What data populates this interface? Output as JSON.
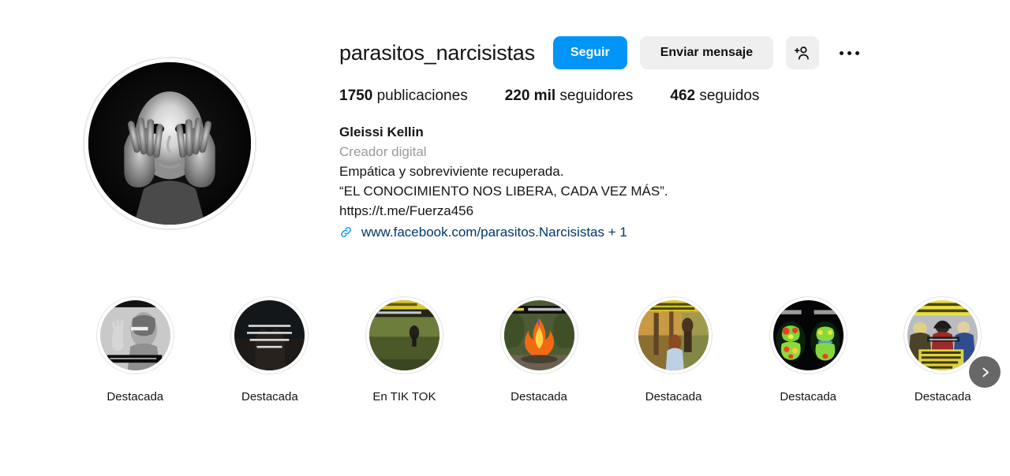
{
  "profile": {
    "username": "parasitos_narcisistas",
    "avatar_alt": "mask-face-held-by-hands-grayscale",
    "follow_label": "Seguir",
    "message_label": "Enviar mensaje",
    "add_person_icon": "add-person-icon",
    "more_options_icon": "ellipsis-icon",
    "stats": {
      "posts_value": "1750",
      "posts_label": "publicaciones",
      "followers_value": "220 mil",
      "followers_label": "seguidores",
      "following_value": "462",
      "following_label": "seguidos"
    },
    "bio": {
      "display_name": "Gleissi Kellin",
      "category": "Creador digital",
      "line1": "Empática y sobreviviente recuperada.",
      "line2": "“EL CONOCIMIENTO NOS LIBERA, CADA VEZ MÁS”.",
      "line3": "https://t.me/Fuerza456",
      "link_icon": "link-chain-icon",
      "link_text": "www.facebook.com/parasitos.Narcisistas + 1"
    }
  },
  "highlights": [
    {
      "label": "Destacada",
      "thumb": "woman-portrait-grayscale-with-hand"
    },
    {
      "label": "Destacada",
      "thumb": "dark-image-with-white-quote-text"
    },
    {
      "label": "En TIK TOK",
      "thumb": "green-field-with-figure-yellow-banner"
    },
    {
      "label": "Destacada",
      "thumb": "campfire-orange-flames"
    },
    {
      "label": "Destacada",
      "thumb": "autumn-outdoor-people-yellow-banner"
    },
    {
      "label": "Destacada",
      "thumb": "brain-scan-heatmap-comparison"
    },
    {
      "label": "Destacada",
      "thumb": "three-men-yellow-text-banners"
    }
  ],
  "controls": {
    "next_highlights_icon": "chevron-right-icon"
  },
  "colors": {
    "accent_blue": "#0095f6",
    "button_gray": "#efefef",
    "link_blue": "#00376b",
    "muted_text": "#9a9a9a"
  }
}
